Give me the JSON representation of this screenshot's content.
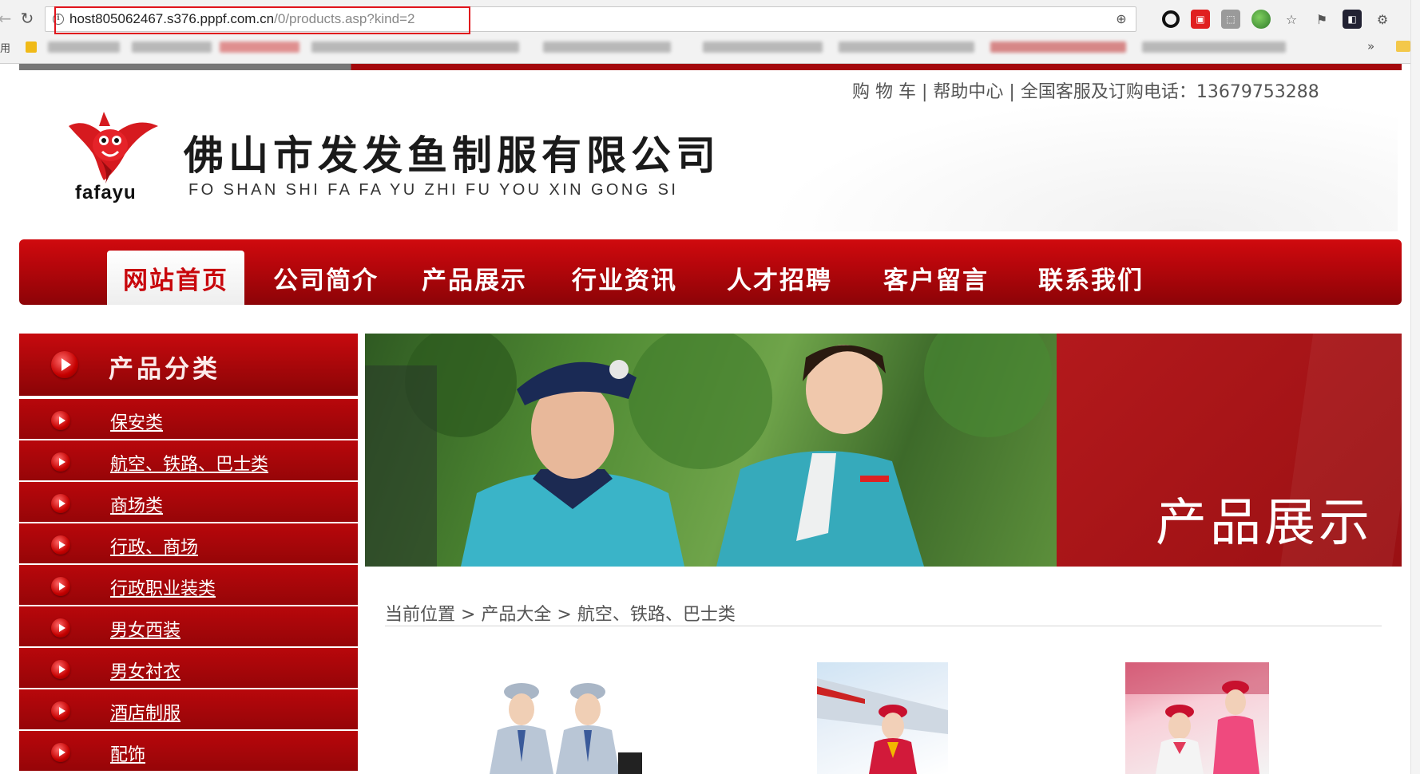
{
  "browser": {
    "url_host": "host805062467.s376.pppf.com.cn",
    "url_path": "/0/products.asp?kind=2",
    "apps_label": "用",
    "more_label": "»",
    "icons": [
      "back-icon",
      "reload-icon",
      "info-icon",
      "zoom-icon",
      "obs-icon",
      "red-extension-icon",
      "pdf-icon",
      "globe-icon",
      "star-icon",
      "bookmark-icon",
      "profile-icon",
      "settings-icon"
    ]
  },
  "topbar": {
    "cart": "购 物 车",
    "sep1": " | ",
    "help": "帮助中心",
    "sep2": " | ",
    "hotline": "全国客服及订购电话：13679753288"
  },
  "logo": {
    "brand_word": "fafayu",
    "company_name": "佛山市发发鱼制服有限公司",
    "company_pinyin": "FO SHAN SHI FA FA YU ZHI FU YOU XIN GONG SI"
  },
  "nav": {
    "items": [
      {
        "label": "网站首页",
        "active": true
      },
      {
        "label": "公司简介",
        "active": false
      },
      {
        "label": "产品展示",
        "active": false
      },
      {
        "label": "行业资讯",
        "active": false
      },
      {
        "label": "人才招聘",
        "active": false
      },
      {
        "label": "客户留言",
        "active": false
      },
      {
        "label": "联系我们",
        "active": false
      }
    ]
  },
  "sidebar": {
    "title": "产品分类",
    "items": [
      {
        "label": "保安类"
      },
      {
        "label": "航空、铁路、巴士类"
      },
      {
        "label": "商场类"
      },
      {
        "label": "行政、商场"
      },
      {
        "label": "行政职业装类"
      },
      {
        "label": "男女西装"
      },
      {
        "label": "男女衬衣"
      },
      {
        "label": "酒店制服"
      },
      {
        "label": "配饰"
      }
    ]
  },
  "banner": {
    "title": "产品展示"
  },
  "breadcrumb": {
    "text": "当前位置 > 产品大全 > 航空、铁路、巴士类"
  },
  "colors": {
    "brand_red": "#b6060b",
    "nav_active_text": "#c8070c",
    "url_highlight": "#e0141c"
  }
}
